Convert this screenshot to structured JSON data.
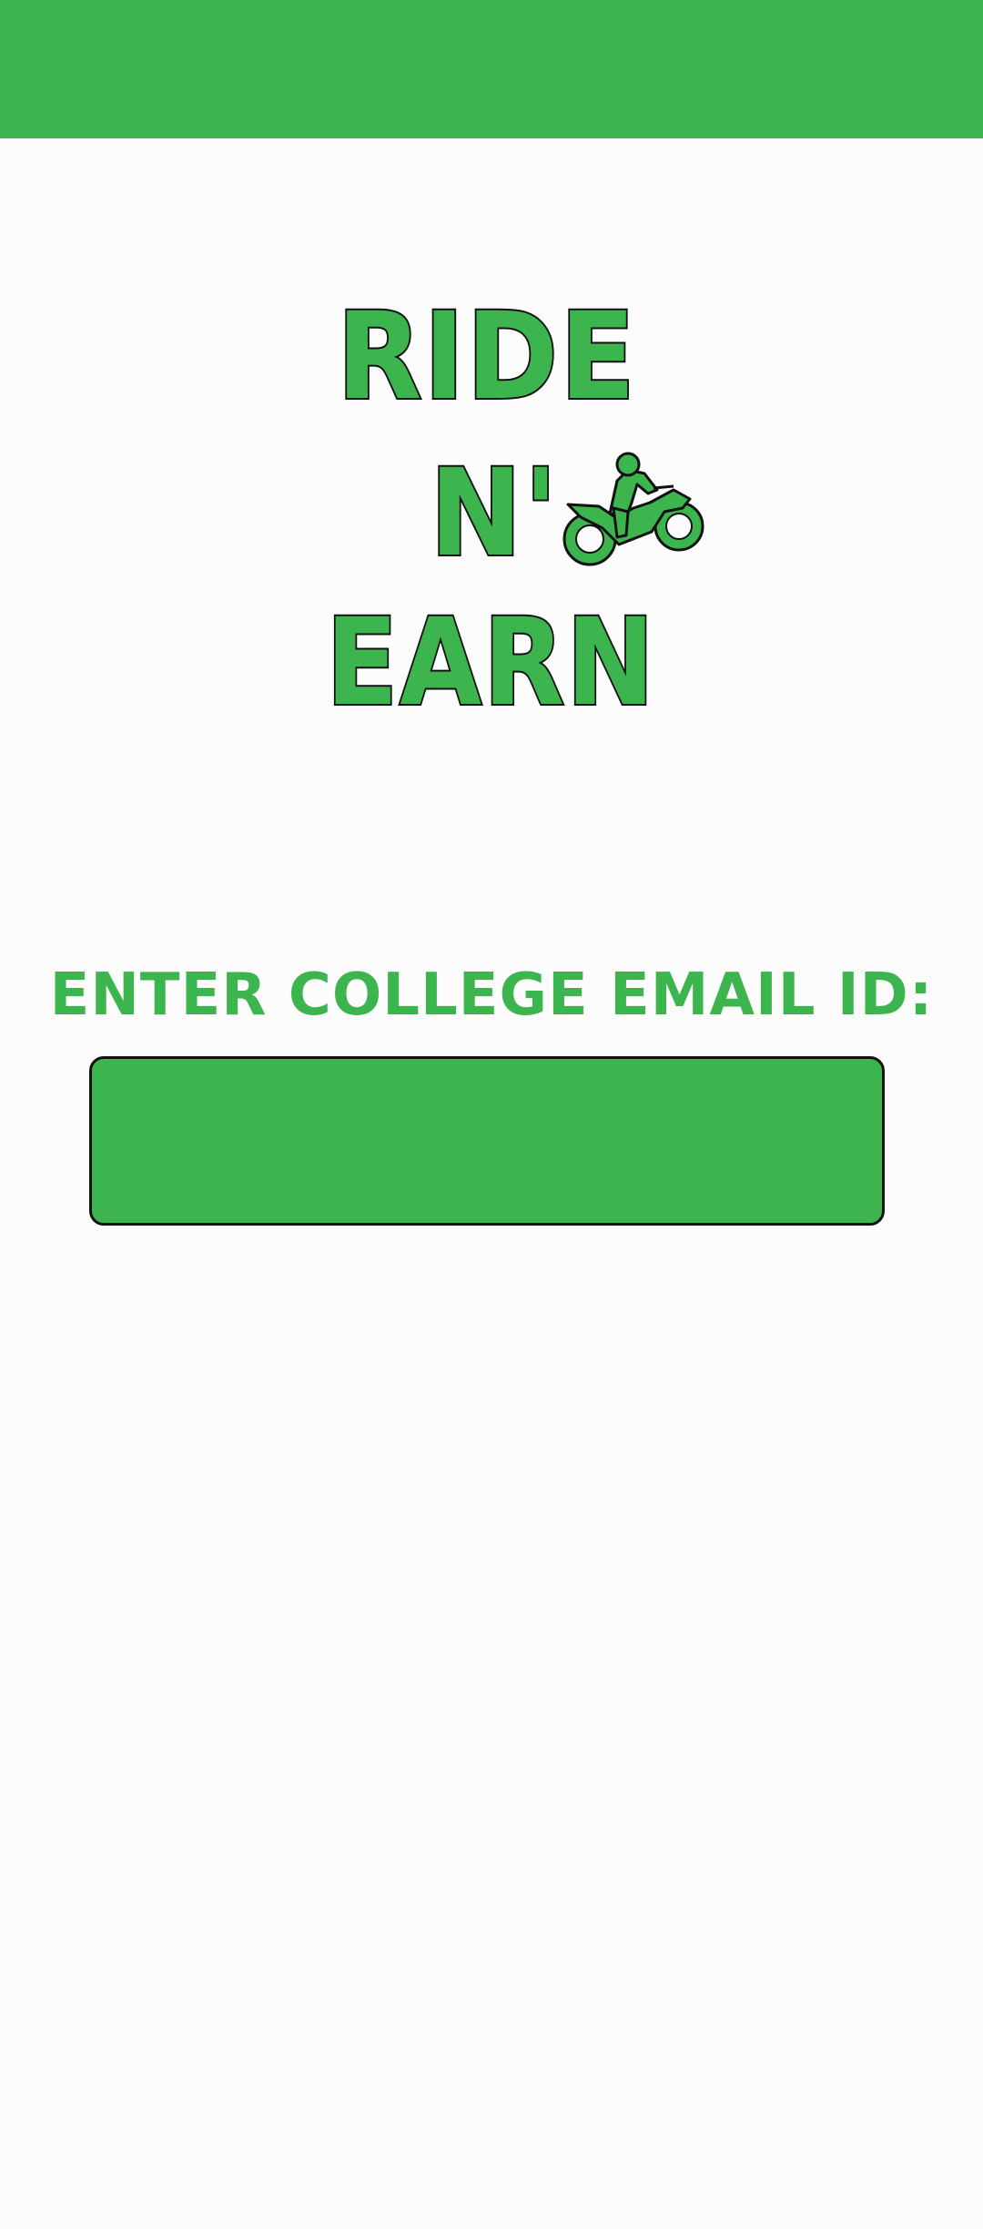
{
  "header": {
    "color": "#3cb54f"
  },
  "logo": {
    "line1": "RIDE",
    "line2": "N'",
    "line3": "EARN",
    "icon": "motorcycle-rider-icon"
  },
  "form": {
    "email_label": "ENTER COLLEGE EMAIL ID:",
    "email_value": "",
    "email_placeholder": ""
  },
  "colors": {
    "brand_green": "#3cb54f",
    "outline": "#111111",
    "background": "#fdfcfd"
  }
}
